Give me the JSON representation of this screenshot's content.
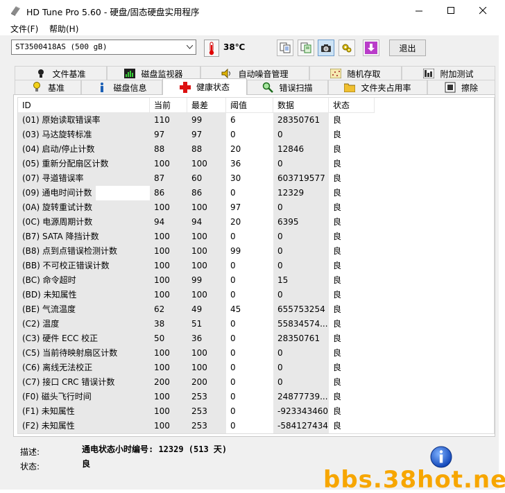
{
  "window": {
    "title": "HD Tune Pro 5.60 - 硬盘/固态硬盘实用程序",
    "minimize": "minimize",
    "maximize": "maximize",
    "close": "close"
  },
  "menu": {
    "items": [
      {
        "label": "文件(F)"
      },
      {
        "label": "帮助(H)"
      }
    ]
  },
  "toolbar": {
    "drive": "ST3500418AS (500 gB)",
    "temperature": "38℃",
    "exit_label": "退出"
  },
  "tabs": {
    "row1": [
      {
        "label": "文件基准",
        "icon": "file-benchmark-icon"
      },
      {
        "label": "磁盘监视器",
        "icon": "disk-monitor-icon"
      },
      {
        "label": "自动噪音管理",
        "icon": "speaker-icon"
      },
      {
        "label": "随机存取",
        "icon": "random-access-icon"
      },
      {
        "label": "附加测试",
        "icon": "extra-tests-icon"
      }
    ],
    "row2": [
      {
        "label": "基准",
        "icon": "benchmark-icon"
      },
      {
        "label": "磁盘信息",
        "icon": "info-icon"
      },
      {
        "label": "健康状态",
        "icon": "health-cross-icon",
        "active": true
      },
      {
        "label": "错误扫描",
        "icon": "magnifier-icon"
      },
      {
        "label": "文件夹占用率",
        "icon": "folder-icon"
      },
      {
        "label": "擦除",
        "icon": "erase-icon"
      }
    ]
  },
  "table": {
    "columns": [
      "ID",
      "当前",
      "最差",
      "阈值",
      "数据",
      "状态"
    ],
    "rows": [
      {
        "id": "(01) 原始读取错误率",
        "current": "110",
        "worst": "99",
        "threshold": "6",
        "data": "28350761",
        "status": "良"
      },
      {
        "id": "(03) 马达旋转标准",
        "current": "97",
        "worst": "97",
        "threshold": "0",
        "data": "0",
        "status": "良"
      },
      {
        "id": "(04) 启动/停止计数",
        "current": "88",
        "worst": "88",
        "threshold": "20",
        "data": "12846",
        "status": "良"
      },
      {
        "id": "(05) 重新分配扇区计数",
        "current": "100",
        "worst": "100",
        "threshold": "36",
        "data": "0",
        "status": "良"
      },
      {
        "id": "(07) 寻道错误率",
        "current": "87",
        "worst": "60",
        "threshold": "30",
        "data": "603719577",
        "status": "良"
      },
      {
        "id": "(09) 通电时间计数",
        "current": "86",
        "worst": "86",
        "threshold": "0",
        "data": "12329",
        "status": "良"
      },
      {
        "id": "(0A) 旋转重试计数",
        "current": "100",
        "worst": "100",
        "threshold": "97",
        "data": "0",
        "status": "良"
      },
      {
        "id": "(0C) 电源周期计数",
        "current": "94",
        "worst": "94",
        "threshold": "20",
        "data": "6395",
        "status": "良"
      },
      {
        "id": "(B7) SATA 降挡计数",
        "current": "100",
        "worst": "100",
        "threshold": "0",
        "data": "0",
        "status": "良"
      },
      {
        "id": "(B8) 点到点错误检测计数",
        "current": "100",
        "worst": "100",
        "threshold": "99",
        "data": "0",
        "status": "良"
      },
      {
        "id": "(BB) 不可校正错误计数",
        "current": "100",
        "worst": "100",
        "threshold": "0",
        "data": "0",
        "status": "良"
      },
      {
        "id": "(BC) 命令超时",
        "current": "100",
        "worst": "99",
        "threshold": "0",
        "data": "15",
        "status": "良"
      },
      {
        "id": "(BD) 未知属性",
        "current": "100",
        "worst": "100",
        "threshold": "0",
        "data": "0",
        "status": "良"
      },
      {
        "id": "(BE) 气流温度",
        "current": "62",
        "worst": "49",
        "threshold": "45",
        "data": "655753254",
        "status": "良"
      },
      {
        "id": "(C2) 温度",
        "current": "38",
        "worst": "51",
        "threshold": "0",
        "data": "55834574...",
        "status": "良"
      },
      {
        "id": "(C3) 硬件 ECC 校正",
        "current": "50",
        "worst": "36",
        "threshold": "0",
        "data": "28350761",
        "status": "良"
      },
      {
        "id": "(C5) 当前待映射扇区计数",
        "current": "100",
        "worst": "100",
        "threshold": "0",
        "data": "0",
        "status": "良"
      },
      {
        "id": "(C6) 离线无法校正",
        "current": "100",
        "worst": "100",
        "threshold": "0",
        "data": "0",
        "status": "良"
      },
      {
        "id": "(C7) 接口 CRC 错误计数",
        "current": "200",
        "worst": "200",
        "threshold": "0",
        "data": "0",
        "status": "良"
      },
      {
        "id": "(F0) 磁头飞行时间",
        "current": "100",
        "worst": "253",
        "threshold": "0",
        "data": "24877739...",
        "status": "良"
      },
      {
        "id": "(F1) 未知属性",
        "current": "100",
        "worst": "253",
        "threshold": "0",
        "data": "-923343460",
        "status": "良"
      },
      {
        "id": "(F2) 未知属性",
        "current": "100",
        "worst": "253",
        "threshold": "0",
        "data": "-584127434",
        "status": "良"
      }
    ]
  },
  "footer": {
    "desc_label": "描述:",
    "desc_value": "通电状态小时编号: 12329 (513 天)",
    "status_label": "状态:",
    "status_value": "良"
  },
  "watermark": "bbs.38hot.net"
}
